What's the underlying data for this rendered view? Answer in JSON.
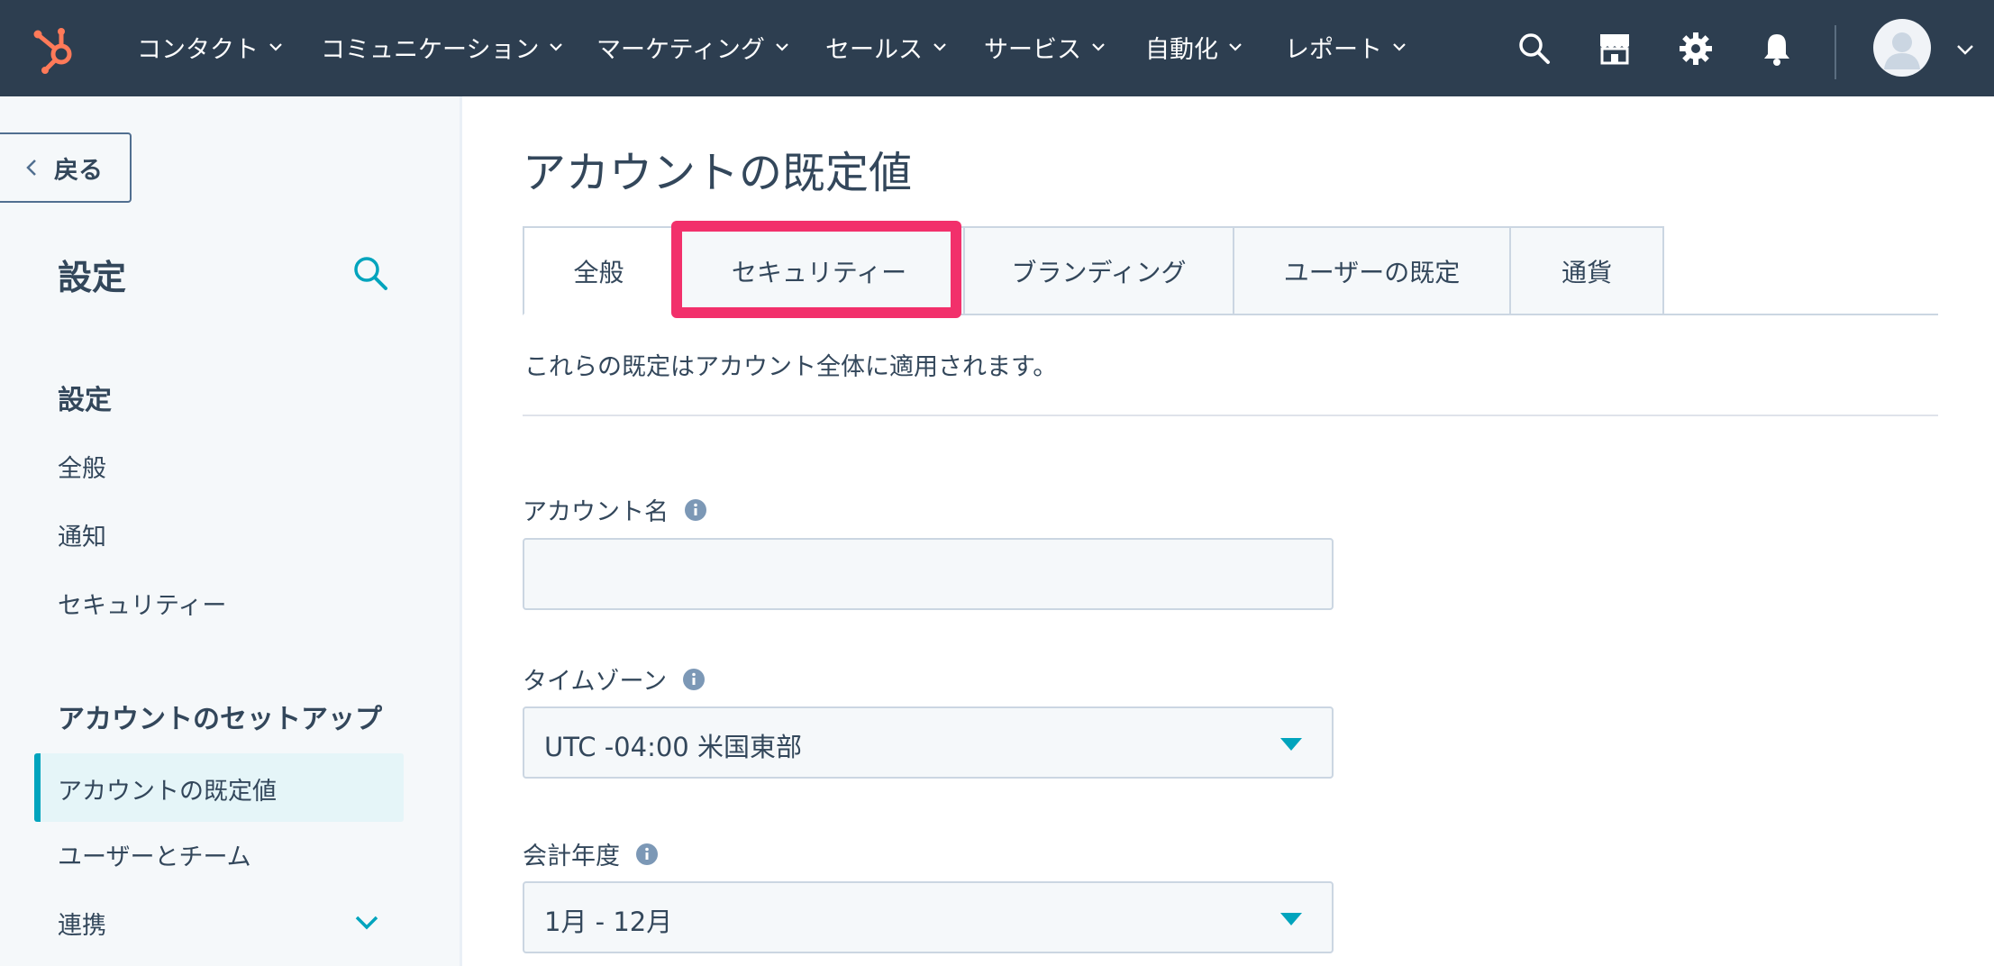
{
  "topnav": {
    "logo_icon": "hubspot-sprocket-icon",
    "items": [
      {
        "label": "コンタクト"
      },
      {
        "label": "コミュニケーション"
      },
      {
        "label": "マーケティング"
      },
      {
        "label": "セールス"
      },
      {
        "label": "サービス"
      },
      {
        "label": "自動化"
      },
      {
        "label": "レポート"
      }
    ],
    "icons": [
      "search-icon",
      "marketplace-icon",
      "gear-icon",
      "bell-icon"
    ],
    "avatar_icon": "user-avatar-icon",
    "bg_color": "#2d3e50",
    "accent_color": "#ff7a59"
  },
  "sidebar": {
    "back_label": "戻る",
    "title": "設定",
    "sections": [
      {
        "heading": "設定",
        "items": [
          {
            "label": "全般"
          },
          {
            "label": "通知"
          },
          {
            "label": "セキュリティー"
          }
        ]
      },
      {
        "heading": "アカウントのセットアップ",
        "items": [
          {
            "label": "アカウントの既定値",
            "active": true
          },
          {
            "label": "ユーザーとチーム"
          },
          {
            "label": "連携"
          }
        ]
      }
    ],
    "active_color": "#00a4bd"
  },
  "main": {
    "title": "アカウントの既定値",
    "tabs": [
      {
        "label": "全般",
        "selected": true
      },
      {
        "label": "セキュリティー",
        "highlighted": true
      },
      {
        "label": "ブランディング"
      },
      {
        "label": "ユーザーの既定"
      },
      {
        "label": "通貨"
      }
    ],
    "highlight_color": "#f2306b",
    "description": "これらの既定はアカウント全体に適用されます。",
    "fields": {
      "account_name": {
        "label": "アカウント名",
        "value": "",
        "placeholder": ""
      },
      "timezone": {
        "label": "タイムゾーン",
        "value": "UTC -04:00 米国東部"
      },
      "fiscal_year": {
        "label": "会計年度",
        "value": "1月 - 12月"
      }
    }
  }
}
